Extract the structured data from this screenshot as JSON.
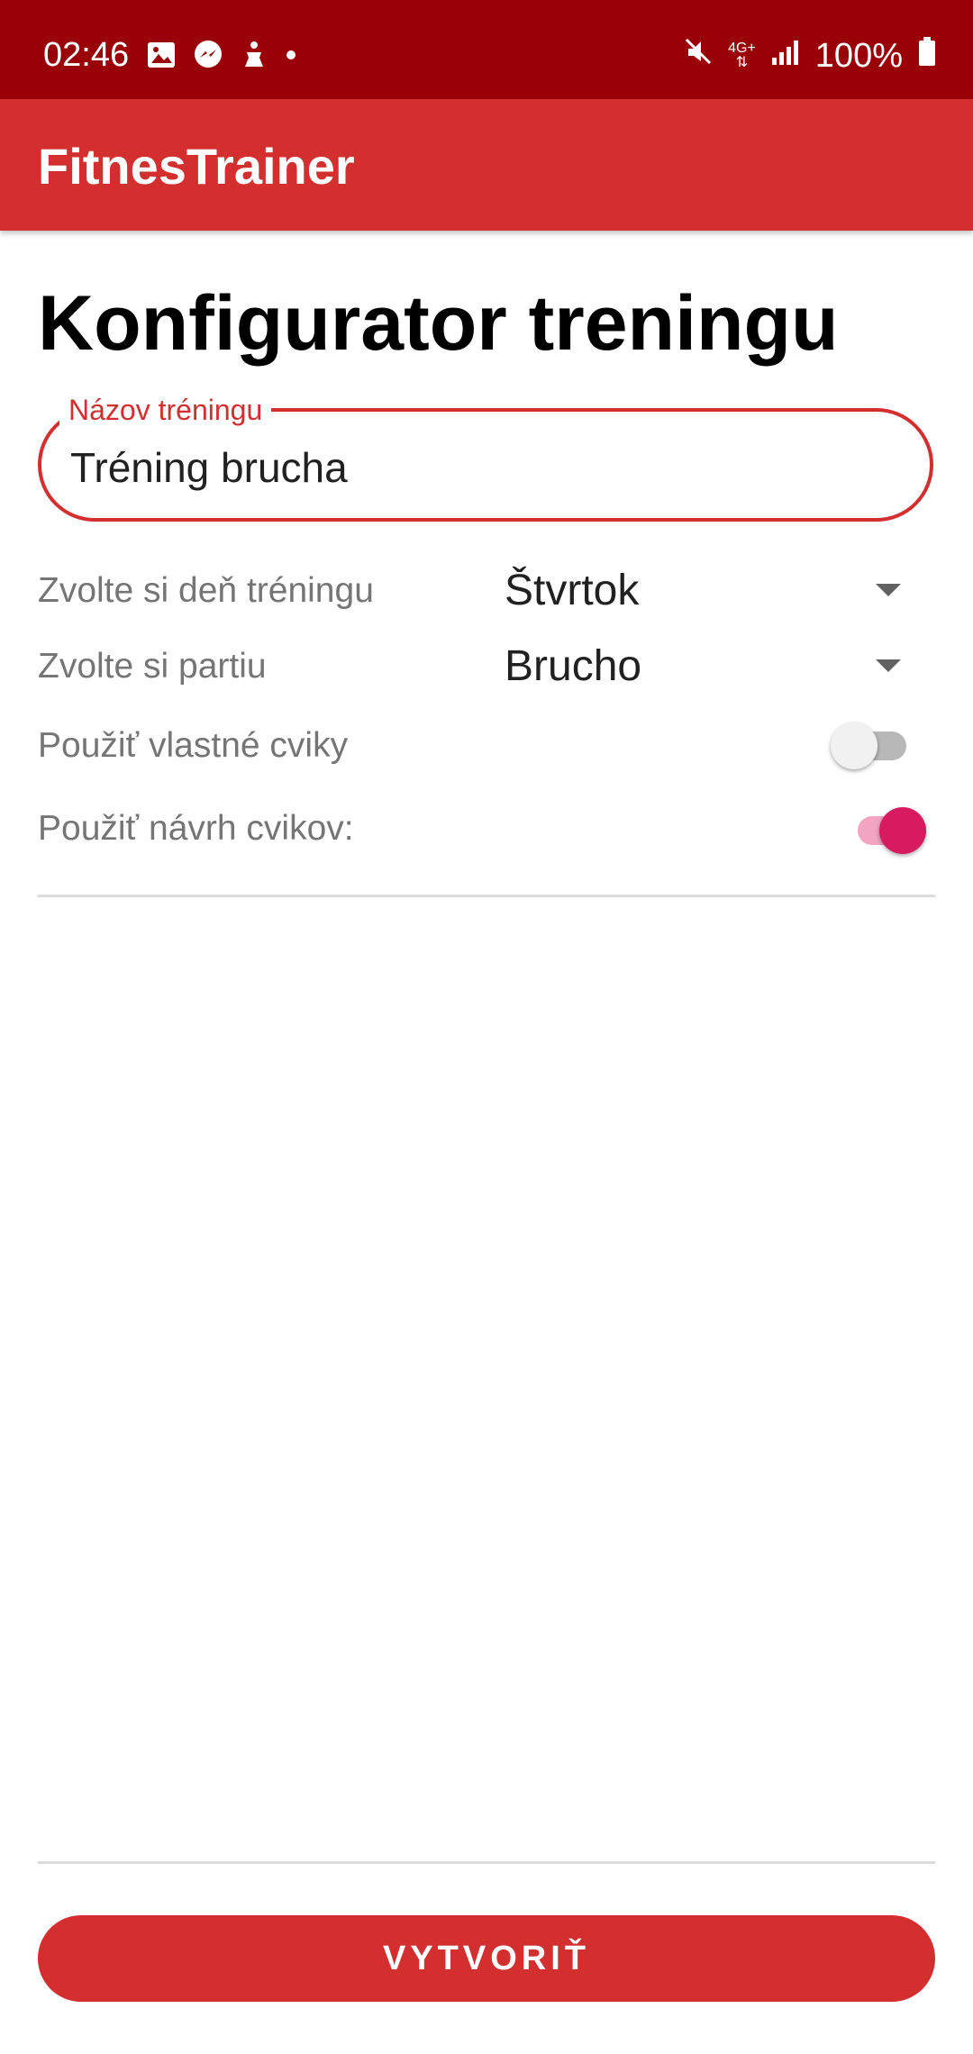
{
  "status_bar": {
    "time": "02:46",
    "battery": "100%",
    "network": "4G+",
    "icons": [
      "gallery-icon",
      "messenger-icon",
      "accessibility-icon",
      "dot-icon",
      "mute-icon",
      "network-4g-icon",
      "signal-icon",
      "battery-icon"
    ]
  },
  "app_bar": {
    "title": "FitnesTrainer"
  },
  "page": {
    "title": "Konfigurator treningu"
  },
  "name_field": {
    "label": "Názov tréningu",
    "value": "Tréning brucha"
  },
  "day_row": {
    "label": "Zvolte si deň tréningu",
    "value": "Štvrtok"
  },
  "part_row": {
    "label": "Zvolte si partiu",
    "value": "Brucho"
  },
  "custom_switch": {
    "label": "Použiť vlastné cviky",
    "checked": false
  },
  "suggest_switch": {
    "label": "Použiť návrh cvikov:",
    "checked": true
  },
  "create_button": {
    "label": "VYTVORIŤ"
  },
  "colors": {
    "status_bar": "#9a0007",
    "app_bar": "#d32f2f",
    "accent": "#d81b60",
    "button": "#d32f2f"
  }
}
